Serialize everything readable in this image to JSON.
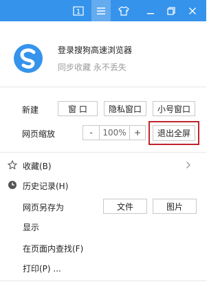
{
  "titlebar": {
    "tab_count": "1",
    "icons": [
      "tab-count-icon",
      "menu-icon",
      "skin-icon",
      "minimize-icon",
      "restore-icon",
      "close-icon"
    ],
    "bg_color": "#3593ec",
    "active_color": "#64acef"
  },
  "account": {
    "title": "登录搜狗高速浏览器",
    "subtitle": "同步收藏 永不丢失"
  },
  "new_row": {
    "label": "新建",
    "window": "窗 口",
    "private": "隐私窗口",
    "small": "小号窗口"
  },
  "zoom_row": {
    "label": "网页缩放",
    "minus": "-",
    "value": "100%",
    "plus": "+",
    "exit_fullscreen": "退出全屏",
    "highlight_color": "#c0232a"
  },
  "menu": {
    "favorites": "收藏(B)",
    "history": "历史记录(H)",
    "save_as": "网页另存为",
    "save_file": "文件",
    "save_image": "图片",
    "display": "显示",
    "find": "在页面内查找(F)",
    "print": "打印(P) ..."
  }
}
